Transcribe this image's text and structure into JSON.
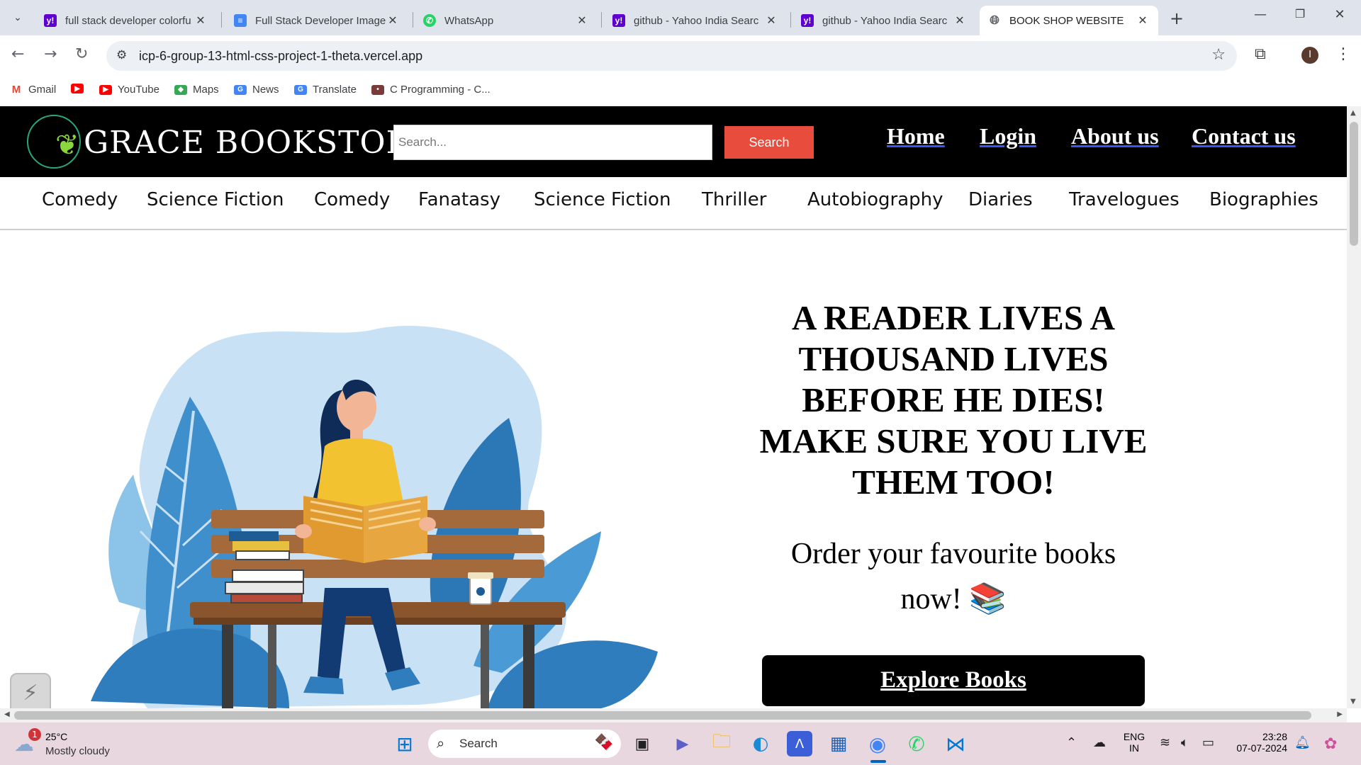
{
  "browser": {
    "tabs": [
      {
        "title": "full stack developer colorfu",
        "favicon": "yahoo-icon",
        "color": "#6001d2"
      },
      {
        "title": "Full Stack Developer Image",
        "favicon": "docs-icon",
        "color": "#4285f4"
      },
      {
        "title": "WhatsApp",
        "favicon": "whatsapp-icon",
        "color": "#25d366"
      },
      {
        "title": "github - Yahoo India Searc",
        "favicon": "yahoo-icon",
        "color": "#6001d2"
      },
      {
        "title": "github - Yahoo India Searc",
        "favicon": "yahoo-icon",
        "color": "#6001d2"
      },
      {
        "title": "BOOK SHOP WEBSITE",
        "favicon": "globe-icon",
        "color": "#5f6368"
      }
    ],
    "active_tab_index": 5,
    "url": "icp-6-group-13-html-css-project-1-theta.vercel.app",
    "profile_initial": "I",
    "bookmarks": [
      {
        "label": "Gmail",
        "icon": "gmail-icon"
      },
      {
        "label": "",
        "icon": "youtube-icon"
      },
      {
        "label": "YouTube",
        "icon": "youtube-icon"
      },
      {
        "label": "Maps",
        "icon": "maps-icon"
      },
      {
        "label": "News",
        "icon": "news-icon"
      },
      {
        "label": "Translate",
        "icon": "translate-icon"
      },
      {
        "label": "C Programming - C...",
        "icon": "site-icon"
      }
    ]
  },
  "site": {
    "logo_text": "GRACE BOOKSTORE",
    "search_placeholder": "Search...",
    "search_button": "Search",
    "nav": [
      "Home",
      "Login",
      "About us",
      "Contact us"
    ],
    "genres": [
      "Comedy",
      "Science Fiction",
      "Comedy",
      "Fanatasy",
      "Science Fiction",
      "Thriller",
      "Autobiography",
      "Diaries",
      "Travelogues",
      "Biographies"
    ],
    "hero_quote": "A READER LIVES A THOUSAND LIVES BEFORE HE DIES! MAKE SURE YOU LIVE THEM TOO!",
    "hero_sub": "Order your favourite books now! 📚",
    "cta": "Explore Books",
    "colors": {
      "header_bg": "#000000",
      "search_button": "#e74c3c",
      "nav_underline": "#3b54f3"
    }
  },
  "taskbar": {
    "weather_temp": "25°C",
    "weather_cond": "Mostly cloudy",
    "weather_badge": "1",
    "search_label": "Search",
    "lang_line1": "ENG",
    "lang_line2": "IN",
    "time": "23:28",
    "date": "07-07-2024"
  }
}
